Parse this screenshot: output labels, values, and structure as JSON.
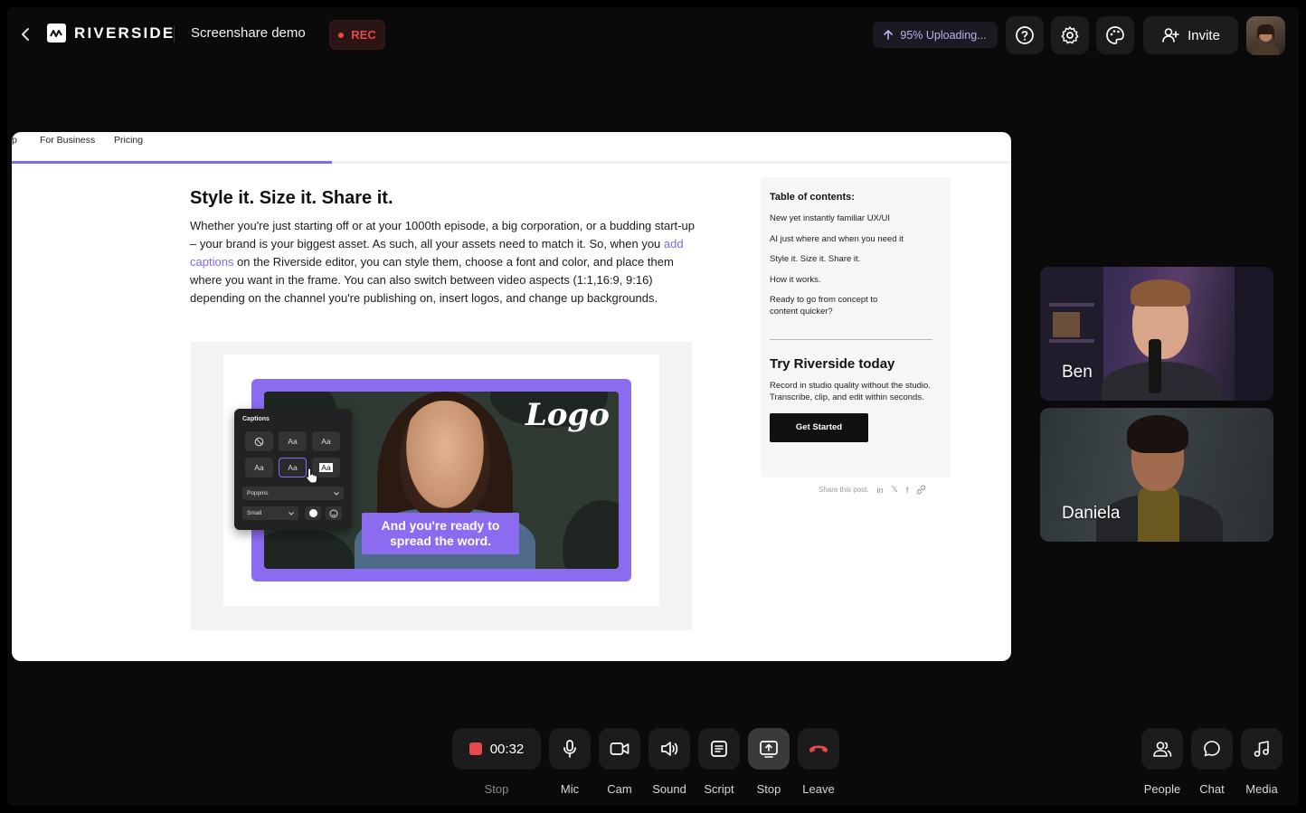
{
  "header": {
    "brand": "RIVERSIDE",
    "session_title": "Screenshare demo",
    "rec_label": "REC",
    "upload_status": "95% Uploading...",
    "invite_label": "Invite"
  },
  "shared_screen": {
    "nav": [
      "p",
      "For Business",
      "Pricing"
    ],
    "read_progress": 0.32,
    "article": {
      "heading": "Style it. Size it. Share it.",
      "para_before_link": "Whether you're just starting off or at your 1000th episode, a big corporation, or a budding start-up – your brand is your biggest asset. As such, all your assets need to match it. So, when you ",
      "link_text": "add captions",
      "para_after_link": " on the Riverside editor, you can style them, choose a font and color, and place them where you want in the frame. You can also switch between video aspects (1:1,16:9, 9:16) depending on the channel you're publishing on, insert logos, and change up backgrounds."
    },
    "figure": {
      "logo_text": "Logo",
      "caption_text": "And you're ready to spread the word.",
      "panel": {
        "title": "Captions",
        "styles": [
          "Aa",
          "Aa",
          "Aa",
          "Aa",
          "Aa"
        ],
        "font": "Poppins",
        "size": "Small"
      }
    },
    "toc": {
      "title": "Table of contents:",
      "items": [
        "New yet instantly familiar UX/UI",
        "AI just where and when you need it",
        "Style it. Size it. Share it.",
        "How it works.",
        "Ready to go from concept to content quicker?"
      ]
    },
    "cta": {
      "title": "Try Riverside today",
      "description": "Record in studio quality without the studio. Transcribe, clip, and edit within seconds.",
      "button": "Get Started"
    },
    "share_label": "Share this post:"
  },
  "participants": [
    {
      "name": "Ben"
    },
    {
      "name": "Daniela"
    }
  ],
  "controls": {
    "timer": "00:32",
    "record_label": "Stop",
    "mic": "Mic",
    "cam": "Cam",
    "sound": "Sound",
    "script": "Script",
    "share_stop": "Stop",
    "leave": "Leave",
    "people": "People",
    "chat": "Chat",
    "media": "Media"
  },
  "colors": {
    "accent": "#7c6be8",
    "rec_red": "#e5484d",
    "leave_red": "#e5484d",
    "panel_bg": "#1c1c1c"
  }
}
